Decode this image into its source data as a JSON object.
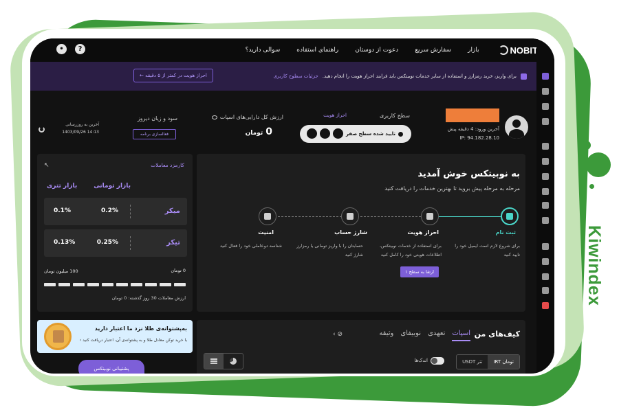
{
  "brand": {
    "watermark": "Kiwindex"
  },
  "topbar": {
    "logo": "NOBIT",
    "nav": [
      "بازار",
      "سفارش سریع",
      "دعوت از دوستان",
      "راهنمای استفاده",
      "سوالی دارید؟"
    ]
  },
  "banner": {
    "text": "برای واریز، خرید رمزارز و استفاده از سایر خدمات نوبیتکس باید فرایند احراز هویت را انجام دهید.",
    "link": "جزئیات سطوح کاربری",
    "button": "احراز هویت در کمتر از ۵ دقیقه ←"
  },
  "profile": {
    "last_login": "آخرین ورود: 4 دقیقه پیش",
    "ip": "IP: 94.182.28.10",
    "level_title": "سطح کاربری",
    "level_link": "احراز هویت",
    "level_status": "تایید شده سطح صفر",
    "assets_title": "ارزش کل دارایی‌های اسپات",
    "assets_value": "0",
    "assets_unit": "تومان",
    "pnl_title": "سود و زیان دیروز",
    "pnl_button": "فعالسازی برنامه",
    "update_label": "آخرین به روزرسانی",
    "update_time": "14:13 1403/09/26"
  },
  "welcome": {
    "title": "به نوبیتکس خوش آمدید",
    "subtitle": "مرحله به مرحله پیش بروید تا بهترین خدمات را دریافت کنید",
    "steps": [
      {
        "title": "ثبت نام",
        "desc": "برای شروع لازم است ایمیل خود را تایید کنید"
      },
      {
        "title": "احراز هویت",
        "desc": "برای استفاده از خدمات نوبیتکس، اطلاعات هویتی خود را کامل کنید"
      },
      {
        "title": "شارژ حساب",
        "desc": "حسابتان را با واریز تومانی یا رمزارز شارژ کنید"
      },
      {
        "title": "امنیت",
        "desc": "شناسه دوعاملی خود را فعال کنید"
      }
    ],
    "upgrade_button": "ارتقا به سطح ۱"
  },
  "fees": {
    "title": "کارمزد معاملات",
    "col_toman": "بازار تومانی",
    "col_tether": "بازار تتری",
    "maker": {
      "label": "میکر",
      "toman": "0.2%",
      "tether": "0.1%"
    },
    "taker": {
      "label": "تیکر",
      "toman": "0.25%",
      "tether": "0.13%"
    },
    "range_start": "0 تومان",
    "range_end": "100 میلیون تومان",
    "volume_text": "ارزش معاملات 30 روز گذشته: 0 تومان"
  },
  "promo": {
    "title": "به‌پشتوانه‌ی طلا نزد ما اعتبار دارید",
    "text": "با خرید توکن معادل طلا و به پشتوانه‌ی آن، اعتبار دریافت کنید ›"
  },
  "support": {
    "label": "پشتیبانی نوبیتکس"
  },
  "wallets": {
    "title": "کیف‌های من",
    "tabs": [
      "اسپات",
      "تعهدی",
      "نوبیفای",
      "وثیقه"
    ],
    "units": [
      "تومان IRT",
      "تتر USDT"
    ],
    "small_label": "اندک‌ها"
  }
}
